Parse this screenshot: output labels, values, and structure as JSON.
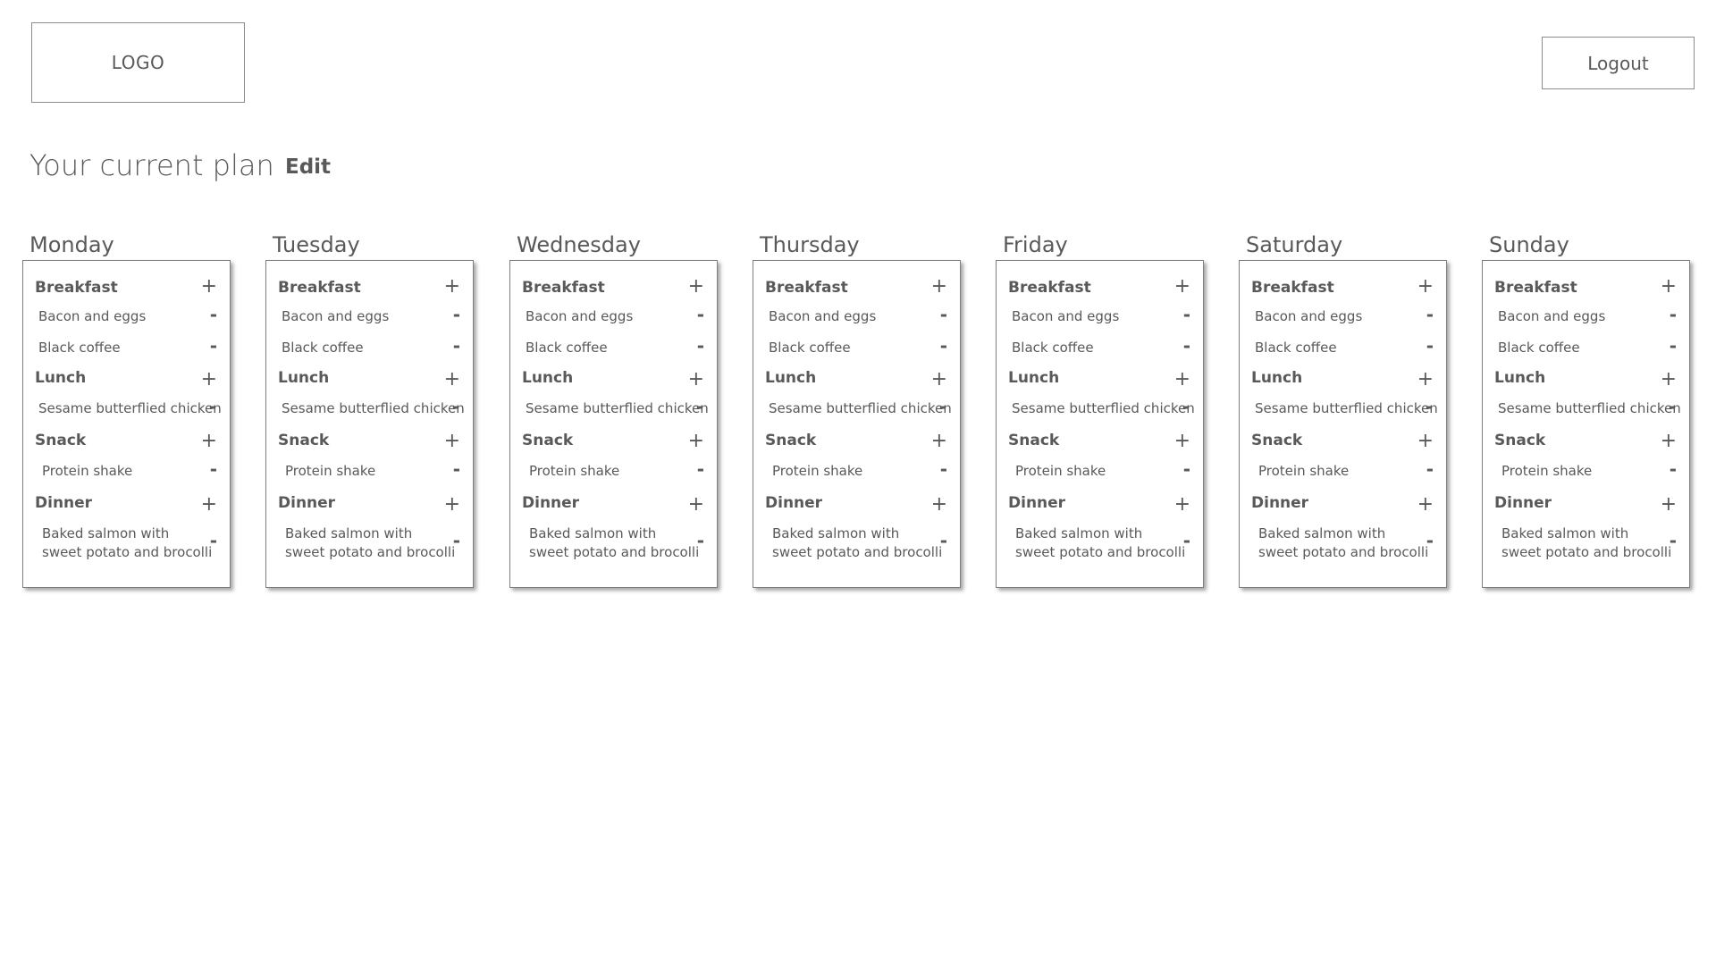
{
  "header": {
    "logo_text": "LOGO",
    "logout_label": "Logout"
  },
  "plan": {
    "title": "Your current plan",
    "edit_label": "Edit"
  },
  "controls": {
    "add_symbol": "+",
    "remove_symbol": "-"
  },
  "meal_labels": {
    "breakfast": "Breakfast",
    "lunch": "Lunch",
    "snack": "Snack",
    "dinner": "Dinner"
  },
  "days": [
    {
      "name": "Monday",
      "breakfast": [
        "Bacon and eggs",
        "Black coffee"
      ],
      "lunch": [
        "Sesame butterflied chicken"
      ],
      "snack": [
        "Protein shake"
      ],
      "dinner": [
        "Baked salmon with",
        "sweet potato and brocolli"
      ]
    },
    {
      "name": "Tuesday",
      "breakfast": [
        "Bacon and eggs",
        "Black coffee"
      ],
      "lunch": [
        "Sesame butterflied chicken"
      ],
      "snack": [
        "Protein shake"
      ],
      "dinner": [
        "Baked salmon with",
        "sweet potato and brocolli"
      ]
    },
    {
      "name": "Wednesday",
      "breakfast": [
        "Bacon and eggs",
        "Black coffee"
      ],
      "lunch": [
        "Sesame butterflied chicken"
      ],
      "snack": [
        "Protein shake"
      ],
      "dinner": [
        "Baked salmon with",
        "sweet potato and brocolli"
      ]
    },
    {
      "name": "Thursday",
      "breakfast": [
        "Bacon and eggs",
        "Black coffee"
      ],
      "lunch": [
        "Sesame butterflied chicken"
      ],
      "snack": [
        "Protein shake"
      ],
      "dinner": [
        "Baked salmon with",
        "sweet potato and brocolli"
      ]
    },
    {
      "name": "Friday",
      "breakfast": [
        "Bacon and eggs",
        "Black coffee"
      ],
      "lunch": [
        "Sesame butterflied chicken"
      ],
      "snack": [
        "Protein shake"
      ],
      "dinner": [
        "Baked salmon with",
        "sweet potato and brocolli"
      ]
    },
    {
      "name": "Saturday",
      "breakfast": [
        "Bacon and eggs",
        "Black coffee"
      ],
      "lunch": [
        "Sesame butterflied chicken"
      ],
      "snack": [
        "Protein shake"
      ],
      "dinner": [
        "Baked salmon with",
        "sweet potato and brocolli"
      ]
    },
    {
      "name": "Sunday",
      "breakfast": [
        "Bacon and eggs",
        "Black coffee"
      ],
      "lunch": [
        "Sesame butterflied chicken"
      ],
      "snack": [
        "Protein shake"
      ],
      "dinner": [
        "Baked salmon with",
        "sweet potato and brocolli"
      ]
    }
  ]
}
